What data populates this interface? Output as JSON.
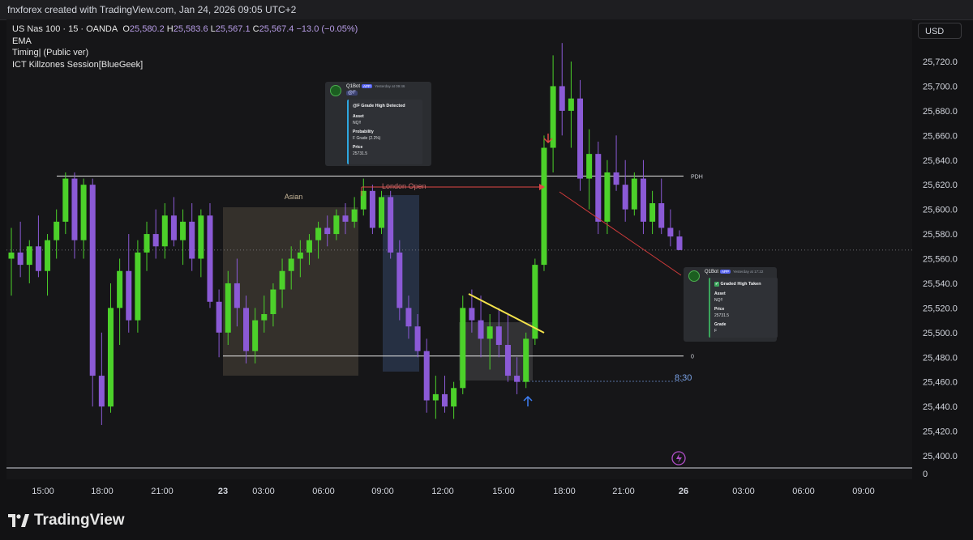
{
  "header": {
    "title": "fnxforex created with TradingView.com, Jan 24, 2026 09:05 UTC+2"
  },
  "symbol": {
    "name": "US Nas 100 · 15 · OANDA",
    "o_label": "O",
    "o": "25,580.2",
    "h_label": "H",
    "h": "25,583.6",
    "l_label": "L",
    "l": "25,567.1",
    "c_label": "C",
    "c": "25,567.4",
    "change": "−13.0 (−0.05%)"
  },
  "indicators": [
    "EMA",
    "Timing| (Public ver)",
    "ICT Killzones Session[BlueGeek]"
  ],
  "currency_button": "USD",
  "price_axis_labels": [
    "25,720.0",
    "25,700.0",
    "25,680.0",
    "25,660.0",
    "25,640.0",
    "25,620.0",
    "25,600.0",
    "25,580.0",
    "25,560.0",
    "25,540.0",
    "25,520.0",
    "25,500.0",
    "25,480.0",
    "25,460.0",
    "25,440.0",
    "25,420.0",
    "25,400.0"
  ],
  "time_axis_labels": [
    "15:00",
    "18:00",
    "21:00",
    "23",
    "03:00",
    "06:00",
    "09:00",
    "12:00",
    "15:00",
    "18:00",
    "21:00",
    "26",
    "03:00",
    "06:00",
    "09:00"
  ],
  "lower_pane_label": "0",
  "annotations": {
    "asian": "Asian",
    "london_open": "London Open",
    "pdh": "PDH",
    "zero_level": "0",
    "time_830": "8:30"
  },
  "card1": {
    "bot": "Q1Bot",
    "app": "APP",
    "time": "Yesterday at 09:46",
    "mention": "@F",
    "title": "@F Grade High Detected",
    "f1_label": "Asset",
    "f1_value": "NQ!!",
    "f2_label": "Probability",
    "f2_value": "F Grade (2.2%)",
    "f3_label": "Price",
    "f3_value": "25731.5"
  },
  "card2": {
    "bot": "Q1Bot",
    "app": "APP",
    "time": "Yesterday at 17:22",
    "title": "Graded High Taken",
    "f1_label": "Asset",
    "f1_value": "NQ!!",
    "f2_label": "Price",
    "f2_value": "25731.5",
    "f3_label": "Grade",
    "f3_value": "F"
  },
  "branding": "TradingView",
  "colors": {
    "bull": "#4cd12a",
    "bear": "#8b5ad6",
    "background": "#161618"
  },
  "chart_data": {
    "type": "candlestick",
    "symbol": "US Nas 100",
    "timeframe": "15",
    "ylim": [
      25390,
      25740
    ],
    "levels": {
      "PDH": 25627,
      "zero_line": 25481
    },
    "series": [
      {
        "o": 25560,
        "h": 25585,
        "l": 25530,
        "c": 25565
      },
      {
        "o": 25565,
        "h": 25590,
        "l": 25545,
        "c": 25555
      },
      {
        "o": 25555,
        "h": 25575,
        "l": 25540,
        "c": 25570
      },
      {
        "o": 25570,
        "h": 25595,
        "l": 25545,
        "c": 25550
      },
      {
        "o": 25550,
        "h": 25580,
        "l": 25530,
        "c": 25575
      },
      {
        "o": 25575,
        "h": 25600,
        "l": 25560,
        "c": 25590
      },
      {
        "o": 25590,
        "h": 25630,
        "l": 25580,
        "c": 25625
      },
      {
        "o": 25625,
        "h": 25630,
        "l": 25560,
        "c": 25575
      },
      {
        "o": 25575,
        "h": 25625,
        "l": 25560,
        "c": 25620
      },
      {
        "o": 25620,
        "h": 25625,
        "l": 25440,
        "c": 25465
      },
      {
        "o": 25465,
        "h": 25500,
        "l": 25425,
        "c": 25440
      },
      {
        "o": 25440,
        "h": 25540,
        "l": 25435,
        "c": 25520
      },
      {
        "o": 25520,
        "h": 25560,
        "l": 25490,
        "c": 25550
      },
      {
        "o": 25550,
        "h": 25580,
        "l": 25500,
        "c": 25510
      },
      {
        "o": 25510,
        "h": 25575,
        "l": 25500,
        "c": 25565
      },
      {
        "o": 25565,
        "h": 25590,
        "l": 25550,
        "c": 25580
      },
      {
        "o": 25580,
        "h": 25600,
        "l": 25560,
        "c": 25570
      },
      {
        "o": 25570,
        "h": 25605,
        "l": 25560,
        "c": 25595
      },
      {
        "o": 25595,
        "h": 25610,
        "l": 25570,
        "c": 25575
      },
      {
        "o": 25575,
        "h": 25600,
        "l": 25555,
        "c": 25590
      },
      {
        "o": 25590,
        "h": 25605,
        "l": 25550,
        "c": 25560
      },
      {
        "o": 25560,
        "h": 25600,
        "l": 25545,
        "c": 25595
      },
      {
        "o": 25595,
        "h": 25605,
        "l": 25520,
        "c": 25525
      },
      {
        "o": 25525,
        "h": 25535,
        "l": 25480,
        "c": 25500
      },
      {
        "o": 25500,
        "h": 25550,
        "l": 25490,
        "c": 25540
      },
      {
        "o": 25540,
        "h": 25560,
        "l": 25505,
        "c": 25520
      },
      {
        "o": 25520,
        "h": 25530,
        "l": 25475,
        "c": 25485
      },
      {
        "o": 25485,
        "h": 25520,
        "l": 25475,
        "c": 25510
      },
      {
        "o": 25510,
        "h": 25530,
        "l": 25500,
        "c": 25515
      },
      {
        "o": 25515,
        "h": 25540,
        "l": 25505,
        "c": 25535
      },
      {
        "o": 25535,
        "h": 25560,
        "l": 25520,
        "c": 25550
      },
      {
        "o": 25550,
        "h": 25570,
        "l": 25535,
        "c": 25560
      },
      {
        "o": 25560,
        "h": 25575,
        "l": 25545,
        "c": 25565
      },
      {
        "o": 25565,
        "h": 25580,
        "l": 25555,
        "c": 25575
      },
      {
        "o": 25575,
        "h": 25590,
        "l": 25560,
        "c": 25585
      },
      {
        "o": 25585,
        "h": 25595,
        "l": 25570,
        "c": 25580
      },
      {
        "o": 25580,
        "h": 25600,
        "l": 25575,
        "c": 25595
      },
      {
        "o": 25595,
        "h": 25605,
        "l": 25580,
        "c": 25590
      },
      {
        "o": 25590,
        "h": 25610,
        "l": 25585,
        "c": 25600
      },
      {
        "o": 25600,
        "h": 25625,
        "l": 25595,
        "c": 25615
      },
      {
        "o": 25615,
        "h": 25620,
        "l": 25580,
        "c": 25585
      },
      {
        "o": 25585,
        "h": 25615,
        "l": 25580,
        "c": 25610
      },
      {
        "o": 25610,
        "h": 25615,
        "l": 25560,
        "c": 25565
      },
      {
        "o": 25565,
        "h": 25575,
        "l": 25510,
        "c": 25520
      },
      {
        "o": 25520,
        "h": 25530,
        "l": 25495,
        "c": 25505
      },
      {
        "o": 25505,
        "h": 25515,
        "l": 25480,
        "c": 25485
      },
      {
        "o": 25485,
        "h": 25495,
        "l": 25435,
        "c": 25445
      },
      {
        "o": 25445,
        "h": 25465,
        "l": 25430,
        "c": 25450
      },
      {
        "o": 25450,
        "h": 25465,
        "l": 25435,
        "c": 25440
      },
      {
        "o": 25440,
        "h": 25460,
        "l": 25430,
        "c": 25455
      },
      {
        "o": 25455,
        "h": 25530,
        "l": 25450,
        "c": 25520
      },
      {
        "o": 25520,
        "h": 25535,
        "l": 25500,
        "c": 25510
      },
      {
        "o": 25510,
        "h": 25530,
        "l": 25480,
        "c": 25495
      },
      {
        "o": 25495,
        "h": 25515,
        "l": 25470,
        "c": 25505
      },
      {
        "o": 25505,
        "h": 25520,
        "l": 25480,
        "c": 25490
      },
      {
        "o": 25490,
        "h": 25515,
        "l": 25460,
        "c": 25465
      },
      {
        "o": 25465,
        "h": 25480,
        "l": 25450,
        "c": 25460
      },
      {
        "o": 25460,
        "h": 25500,
        "l": 25455,
        "c": 25495
      },
      {
        "o": 25495,
        "h": 25560,
        "l": 25490,
        "c": 25555
      },
      {
        "o": 25555,
        "h": 25660,
        "l": 25550,
        "c": 25650
      },
      {
        "o": 25650,
        "h": 25725,
        "l": 25630,
        "c": 25700
      },
      {
        "o": 25700,
        "h": 25735,
        "l": 25660,
        "c": 25680
      },
      {
        "o": 25680,
        "h": 25720,
        "l": 25650,
        "c": 25690
      },
      {
        "o": 25690,
        "h": 25705,
        "l": 25615,
        "c": 25625
      },
      {
        "o": 25625,
        "h": 25665,
        "l": 25600,
        "c": 25645
      },
      {
        "o": 25645,
        "h": 25655,
        "l": 25580,
        "c": 25590
      },
      {
        "o": 25590,
        "h": 25640,
        "l": 25580,
        "c": 25630
      },
      {
        "o": 25630,
        "h": 25660,
        "l": 25615,
        "c": 25620
      },
      {
        "o": 25620,
        "h": 25640,
        "l": 25590,
        "c": 25600
      },
      {
        "o": 25600,
        "h": 25630,
        "l": 25595,
        "c": 25625
      },
      {
        "o": 25625,
        "h": 25640,
        "l": 25580,
        "c": 25590
      },
      {
        "o": 25590,
        "h": 25615,
        "l": 25580,
        "c": 25605
      },
      {
        "o": 25605,
        "h": 25625,
        "l": 25580,
        "c": 25585
      },
      {
        "o": 25585,
        "h": 25600,
        "l": 25570,
        "c": 25578
      },
      {
        "o": 25578,
        "h": 25583,
        "l": 25567,
        "c": 25567
      }
    ]
  }
}
